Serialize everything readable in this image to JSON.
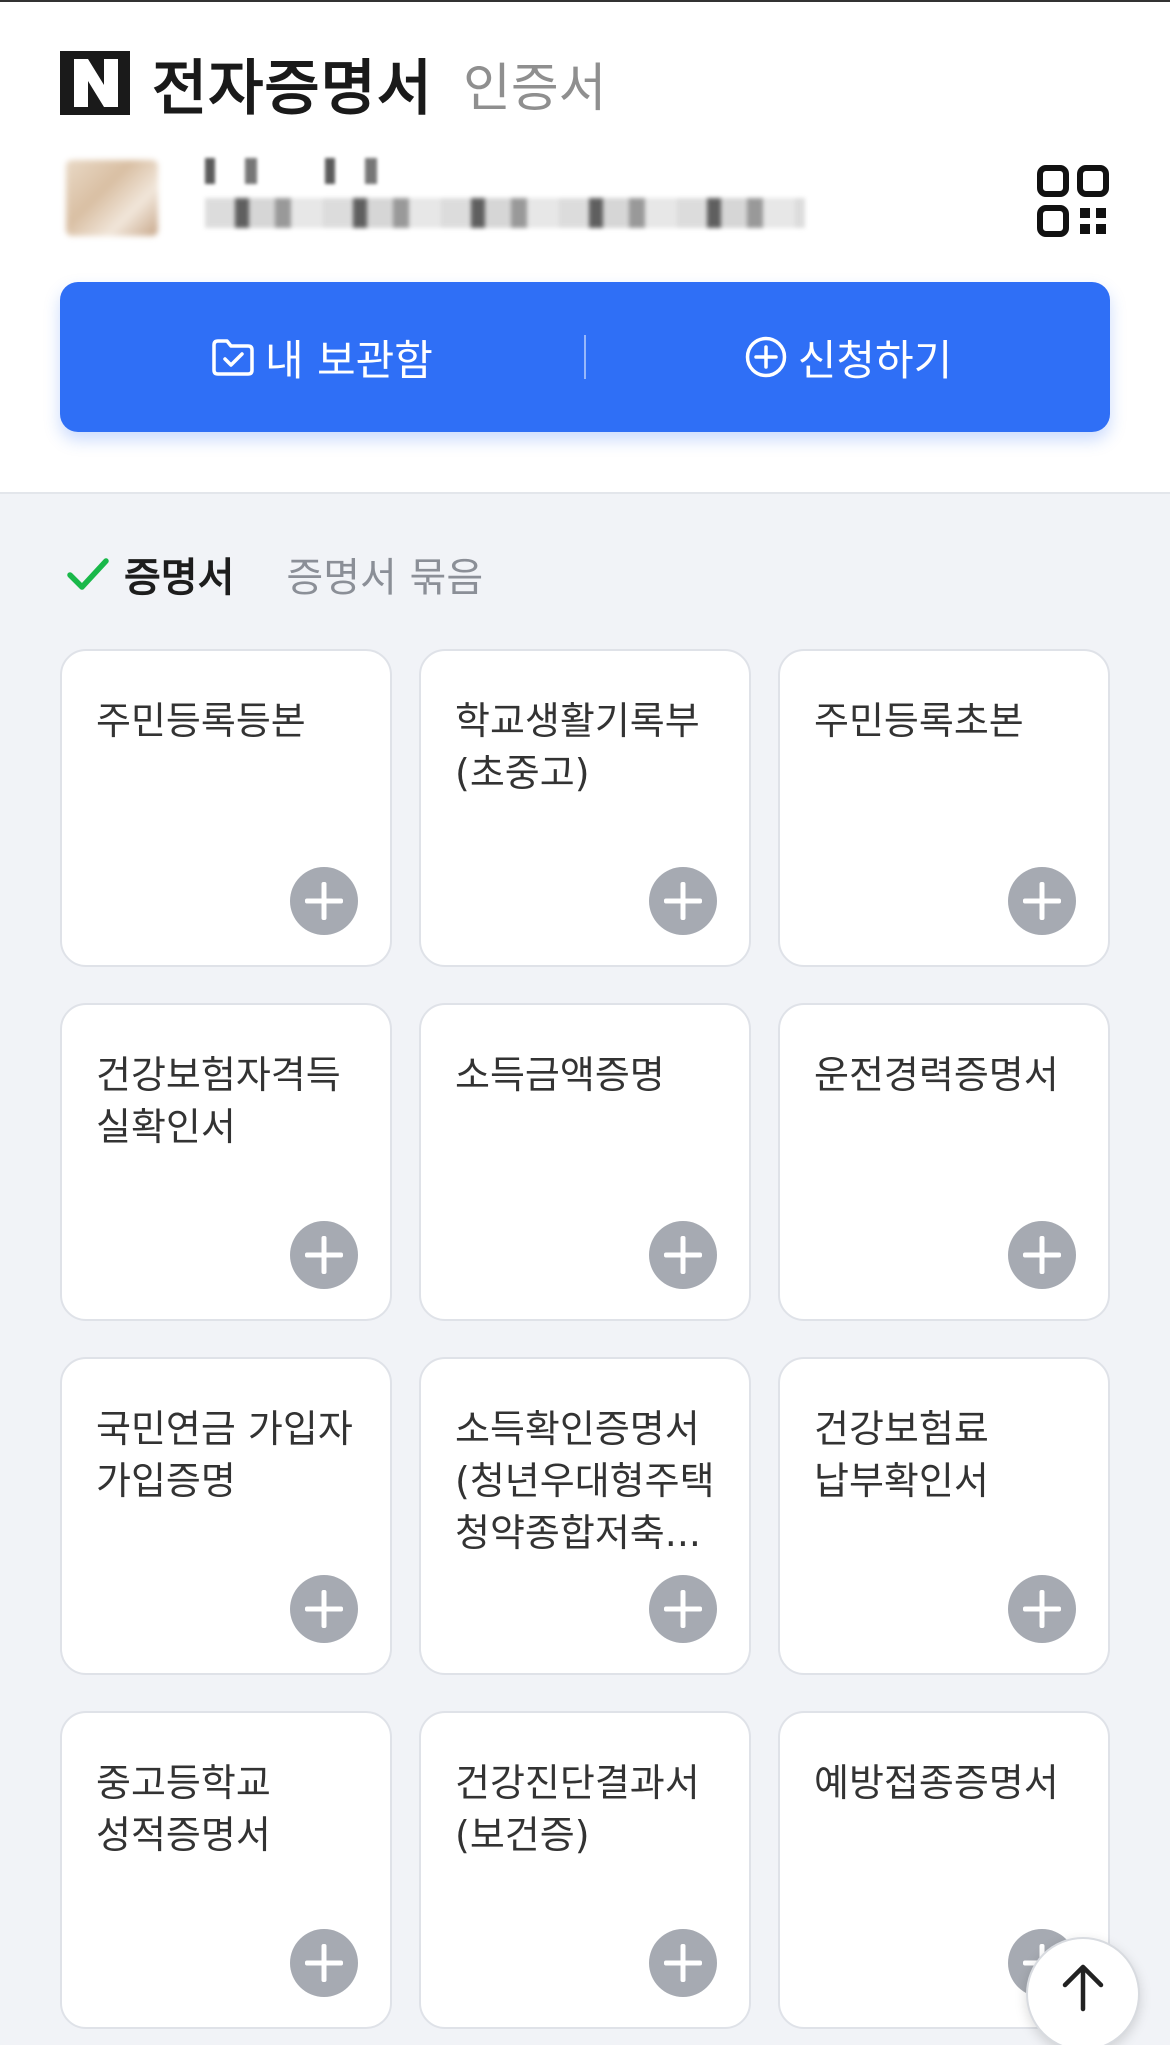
{
  "header": {
    "logo_icon": "naver-n-logo",
    "title": "전자증명서",
    "subtitle": "인증서"
  },
  "user": {
    "avatar_icon": "blurred-avatar",
    "qr_icon": "qr-code-icon"
  },
  "actions": {
    "storage_label": "내 보관함",
    "storage_icon": "folder-check-icon",
    "apply_label": "신청하기",
    "apply_icon": "plus-circle-icon"
  },
  "tabs": {
    "active_label": "증명서",
    "active_icon": "check-icon",
    "inactive_label": "증명서 묶음"
  },
  "certificates": [
    {
      "label": "주민등록등본"
    },
    {
      "label": "학교생활기록부(초중고)"
    },
    {
      "label": "주민등록초본"
    },
    {
      "label": "건강보험자격득실확인서"
    },
    {
      "label": "소득금액증명"
    },
    {
      "label": "운전경력증명서"
    },
    {
      "label": "국민연금 가입자 가입증명"
    },
    {
      "label": "소득확인증명서(청년우대형주택청약종합저축..."
    },
    {
      "label": "건강보험료 납부확인서"
    },
    {
      "label": "중고등학교 성적증명서"
    },
    {
      "label": "건강진단결과서(보건증)"
    },
    {
      "label": "예방접종증명서"
    }
  ],
  "colors": {
    "primary": "#2f6ff6",
    "check": "#19b84a",
    "background": "#f1f3f7",
    "add_button": "#a6aab2"
  },
  "scroll_top_icon": "arrow-up-icon"
}
